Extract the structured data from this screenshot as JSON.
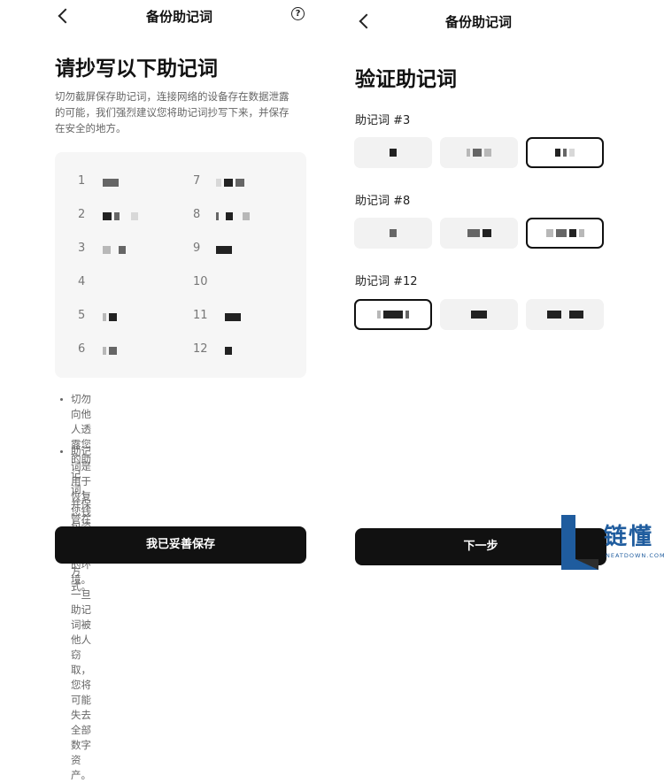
{
  "left": {
    "nav_title": "备份助记词",
    "title": "请抄写以下助记词",
    "description_lines": [
      "切勿截屏保存助记词，连接网络的设备存在数据泄露",
      "的可能，我们强烈建议您将助记词抄写下来，并保存",
      "在安全的地方。"
    ],
    "words": [
      {
        "n": "1"
      },
      {
        "n": "2"
      },
      {
        "n": "3"
      },
      {
        "n": "4"
      },
      {
        "n": "5"
      },
      {
        "n": "6"
      },
      {
        "n": "7"
      },
      {
        "n": "8"
      },
      {
        "n": "9"
      },
      {
        "n": "10"
      },
      {
        "n": "11"
      },
      {
        "n": "12"
      }
    ],
    "bullets": [
      [
        "切勿向他人透露您的助记词，并保管在隔离网络",
        "的环境。一旦助记词被他人窃取，您将可能失去",
        "全部数字资产。"
      ],
      [
        "助记词是用于恢复您钱包资产的唯一方式。"
      ]
    ],
    "button_label": "我已妥善保存",
    "icons": {
      "back": "back-arrow-icon",
      "help": "help-icon"
    },
    "help_glyph": "?"
  },
  "right": {
    "nav_title": "备份助记词",
    "title": "验证助记词",
    "sections": [
      {
        "label": "助记词 #3"
      },
      {
        "label": "助记词 #8"
      },
      {
        "label": "助记词 #12"
      }
    ],
    "button_label": "下一步"
  },
  "watermark": {
    "text": "链懂",
    "sub": "NEATDOWN.COM",
    "colors": {
      "primary": "#1f5c9e",
      "accent": "#2d2d2d"
    }
  }
}
